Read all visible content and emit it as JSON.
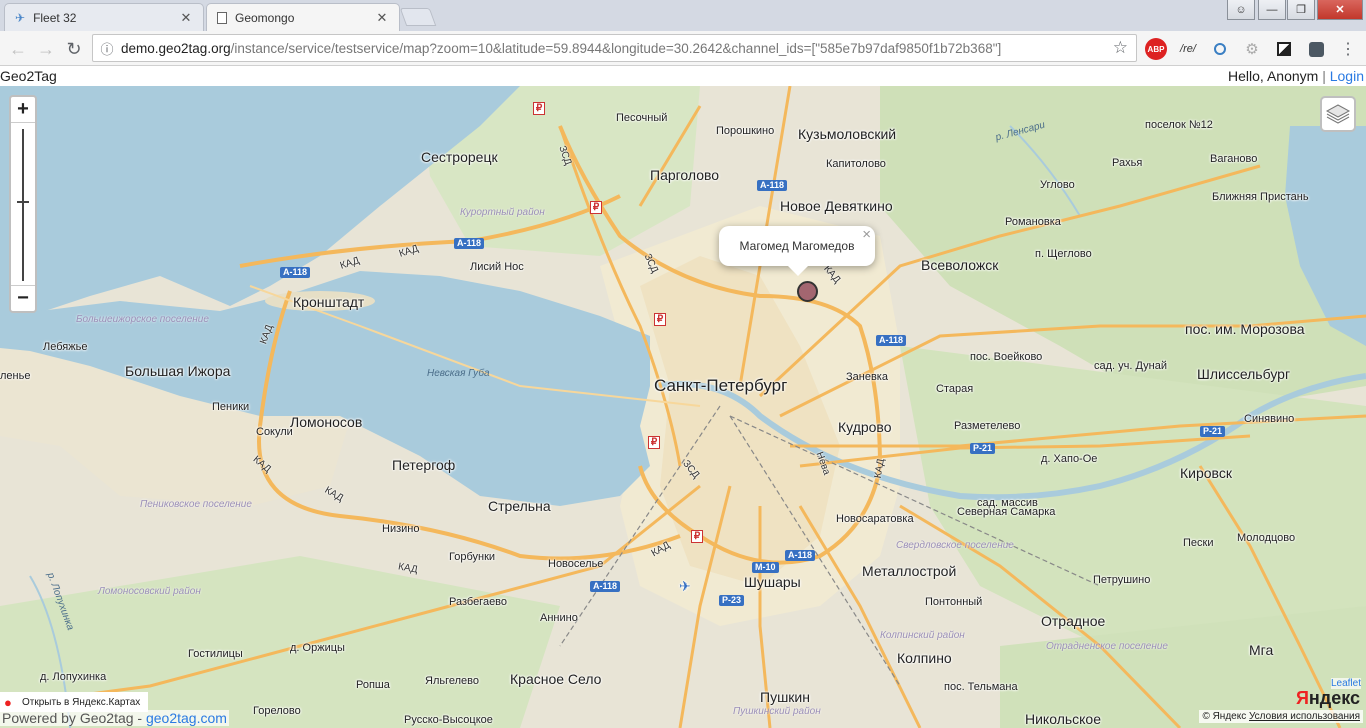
{
  "browser": {
    "tabs": [
      {
        "label": "Fleet 32",
        "icon": "fleet-favicon"
      },
      {
        "label": "Geomongo",
        "icon": "page-icon"
      }
    ],
    "window_controls": {
      "user": "☺",
      "minimize": "—",
      "restore": "❐",
      "close": "✕"
    },
    "url_host": "demo.geo2tag.org",
    "url_path": "/instance/service/testservice/map?zoom=10&latitude=59.8944&longitude=30.2642&channel_ids=[\"585e7b97daf9850f1b72b368\"]",
    "extensions": {
      "abp": "ABP",
      "re": "/re/"
    }
  },
  "app": {
    "brand": "Geo2Tag",
    "greeting": "Hello, Anonym",
    "separator": "|",
    "login": "Login"
  },
  "map": {
    "zoom_in": "+",
    "zoom_out": "−",
    "zoom_level": 10,
    "popup_text": "Магомед Магомедов",
    "popup_close": "×",
    "yandex_open": "Открыть в Яндекс.Картах",
    "powered_by": "Powered by Geo2tag - ",
    "powered_link": "geo2tag.com",
    "leaflet": "Leaflet",
    "yandex_logo_first": "Я",
    "yandex_logo_rest": "ндекс",
    "copyright": "© Яндекс",
    "terms": "Условия использования",
    "places": {
      "spb": "Санкт-Петербург",
      "sestroretsk": "Сестрорецк",
      "kronshtadt": "Кронштадт",
      "lomonosov": "Ломоносов",
      "peterhof": "Петергоф",
      "strelna": "Стрельна",
      "pargolovo": "Парголово",
      "novoe_devyatkino": "Новое Девяткино",
      "kuzmolovsky": "Кузьмоловский",
      "vsevolozhsk": "Всеволожск",
      "morozova": "пос. им. Морозова",
      "shlisselburg": "Шлиссельбург",
      "kirovsk": "Кировск",
      "kudrovo": "Кудрово",
      "shushary": "Шушары",
      "metallostroy": "Металлострой",
      "otradnoe": "Отрадное",
      "kolpino": "Колпино",
      "pushkin": "Пушкин",
      "krasnoe_selo": "Красное Село",
      "nikolskoe": "Никольское",
      "bolshaya_izhora": "Большая Ижора",
      "mga": "Мга",
      "pesochny": "Песочный",
      "poroshkino": "Порошкино",
      "kapitolovo": "Капитолово",
      "lisiy_nos": "Лисий Нос",
      "poselok12": "поселок №12",
      "rakhya": "Рахья",
      "vaganovo": "Ваганово",
      "uglovo": "Углово",
      "blizhnyaya": "Ближняя Пристань",
      "romanovka": "Романовка",
      "shchoglovo": "п. Щеглово",
      "voeykovo": "пос. Воейково",
      "dunay": "сад. уч. Дунай",
      "zanevka": "Заневка",
      "staraya": "Старая",
      "razmetelevo": "Разметелево",
      "sinyavino": "Синявино",
      "khapo_oe": "д. Хапо-Ое",
      "massiv": "сад. массив",
      "samarka": "Северная Самарка",
      "novosaratovka": "Новосаратовка",
      "molodtsovo": "Молодцово",
      "peski": "Пески",
      "petrushino": "Петрушино",
      "pontonny": "Понтонный",
      "telmana": "пос. Тельмана",
      "lebyazhye": "Лебяжье",
      "peniki": "Пеники",
      "sokuli": "Сокули",
      "nizino": "Низино",
      "gorbunki": "Горбунки",
      "novoselye": "Новоселье",
      "razbegaevo": "Разбегаево",
      "annino": "Аннино",
      "gostilitsy": "Гостилицы",
      "orzhitsy": "д. Оржицы",
      "lopukhinka": "д. Лопухинка",
      "ropsha": "Ропша",
      "yalgelevo": "Яльгелево",
      "russko": "Русско-Высоцкое",
      "gorelovo": "Горелово",
      "lenye": "ленье"
    },
    "water": {
      "neva_bay": "Невская Губа",
      "lensari": "р. Ленсари",
      "lopukhinka_r": "р. Лопухинка"
    },
    "regions": {
      "kurortny": "Курортный район",
      "bolsheizhorskoe": "Большеижорское поселение",
      "penikovskoe": "Пениковское поселение",
      "lomonosovsky": "Ломоносовский район",
      "sverdlovskoe": "Свердловское поселение",
      "kolpinsky": "Колпинский район",
      "otradnenskoe": "Отрадненское поселение",
      "pushkinsky": "Пушкинский район"
    },
    "shields": {
      "a118": "A-118",
      "m10": "M-10",
      "r23": "P-23",
      "r21": "P-21"
    },
    "roads": {
      "kad": "КАД",
      "zsd": "ЗСД",
      "neva": "Нева"
    },
    "toll": "₽",
    "airport": "✈",
    "colors": {
      "water": "#a9cbdc",
      "forest": "#c8dcb0",
      "urban": "#f1ead2",
      "road": "#f4b85c",
      "marker": "#a36670",
      "link": "#2a7ae2"
    }
  }
}
